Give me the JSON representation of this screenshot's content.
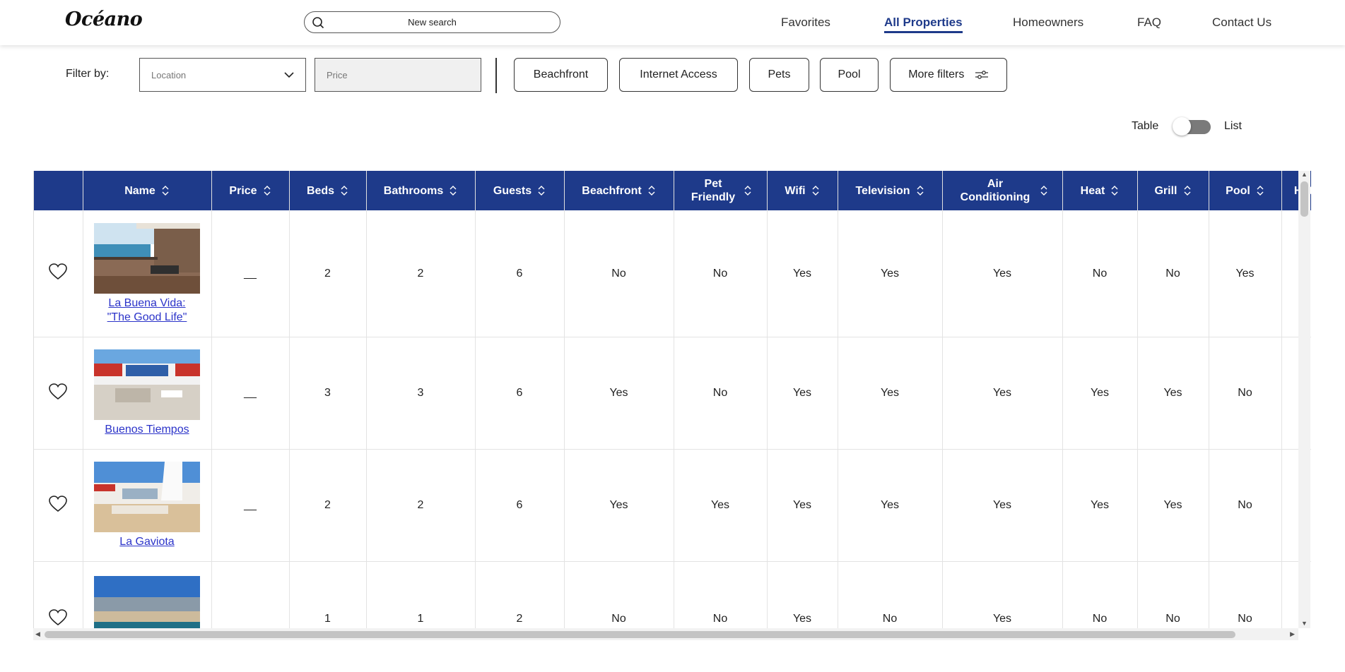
{
  "header": {
    "logo": "Océano",
    "search_placeholder": "New search",
    "nav": [
      "Favorites",
      "All Properties",
      "Homeowners",
      "FAQ",
      "Contact Us"
    ],
    "active_nav": "All Properties"
  },
  "filters": {
    "label": "Filter by:",
    "location_placeholder": "Location",
    "price_placeholder": "Price",
    "chips": [
      "Beachfront",
      "Internet Access",
      "Pets",
      "Pool"
    ],
    "more_filters": "More filters"
  },
  "view_toggle": {
    "left": "Table",
    "right": "List",
    "selected": "Table"
  },
  "table": {
    "columns": [
      "Name",
      "Price",
      "Beds",
      "Bathrooms",
      "Guests",
      "Beachfront",
      "Pet Friendly",
      "Wifi",
      "Television",
      "Air Conditioning",
      "Heat",
      "Grill",
      "Pool",
      "Hot Tub"
    ],
    "rows": [
      {
        "name": "La Buena Vida: \"The Good Life\"",
        "price": "__",
        "beds": "2",
        "bathrooms": "2",
        "guests": "6",
        "beachfront": "No",
        "pet_friendly": "No",
        "wifi": "Yes",
        "television": "Yes",
        "air_conditioning": "Yes",
        "heat": "No",
        "grill": "No",
        "pool": "Yes",
        "image": "balcony-ocean-view"
      },
      {
        "name": "Buenos Tiempos",
        "price": "__",
        "beds": "3",
        "bathrooms": "3",
        "guests": "6",
        "beachfront": "Yes",
        "pet_friendly": "No",
        "wifi": "Yes",
        "television": "Yes",
        "air_conditioning": "Yes",
        "heat": "Yes",
        "grill": "Yes",
        "pool": "No",
        "image": "white-house-patio"
      },
      {
        "name": "La Gaviota",
        "price": "__",
        "beds": "2",
        "bathrooms": "2",
        "guests": "6",
        "beachfront": "Yes",
        "pet_friendly": "Yes",
        "wifi": "Yes",
        "television": "Yes",
        "air_conditioning": "Yes",
        "heat": "Yes",
        "grill": "Yes",
        "pool": "No",
        "image": "beach-house-sand"
      },
      {
        "name": "",
        "price": "",
        "beds": "1",
        "bathrooms": "1",
        "guests": "2",
        "beachfront": "No",
        "pet_friendly": "No",
        "wifi": "Yes",
        "television": "No",
        "air_conditioning": "Yes",
        "heat": "No",
        "grill": "No",
        "pool": "No",
        "image": "aerial-beach"
      }
    ]
  },
  "colors": {
    "header_bg": "#1e3a8a",
    "link": "#2b33c9",
    "active_nav": "#1e3a8a"
  }
}
